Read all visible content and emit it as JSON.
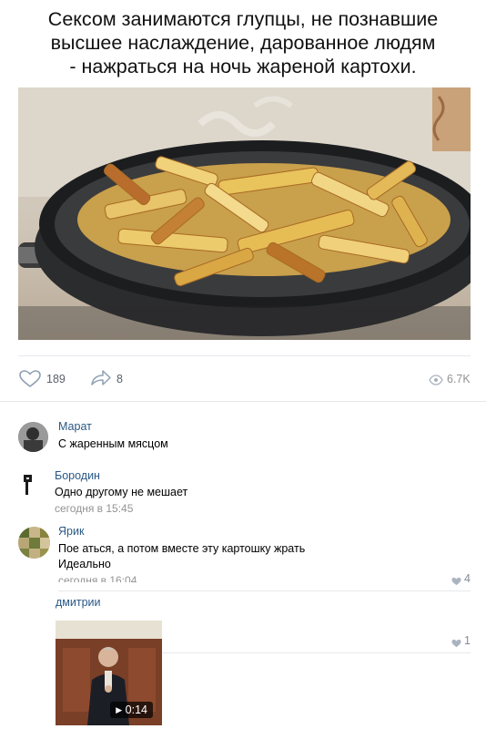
{
  "meme": {
    "caption_lines": [
      "Сексом занимаются глупцы, не познавшие",
      "высшее наслаждение, дарованное людям",
      "- нажраться на ночь жареной картохи."
    ]
  },
  "post_stats": {
    "likes": "189",
    "shares": "8",
    "views": "6.7K"
  },
  "comments": [
    {
      "author": "Марат",
      "text": "С жаренным мясцом"
    },
    {
      "author": "Бородин",
      "text": "Одно другому не мешает",
      "date": "сегодня в 15:45"
    },
    {
      "author": "Ярик",
      "text_lines": [
        "Пое аться, а потом вместе эту картошку жрать",
        "Идеально"
      ],
      "date": "сегодня в 16:04",
      "likes": "4"
    },
    {
      "author": "дмитрии",
      "likes": "1",
      "video_duration": "0:14"
    }
  ],
  "colors": {
    "link": "#2a5885",
    "meta": "#939393",
    "divider": "#e7e8ec"
  }
}
